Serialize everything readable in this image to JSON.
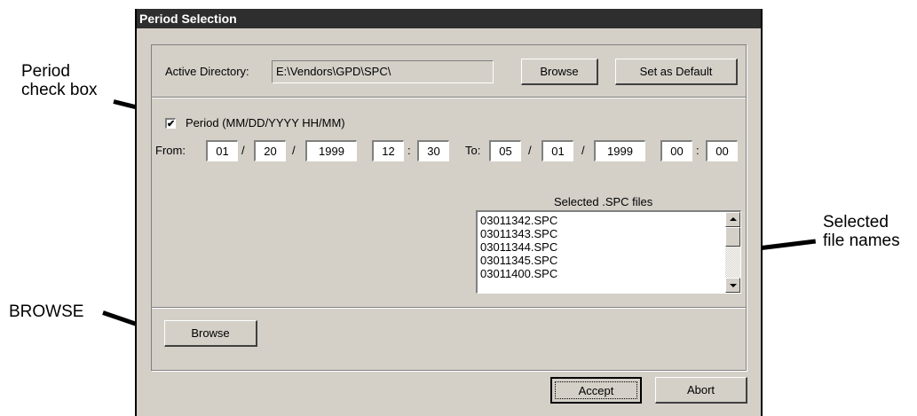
{
  "callouts": {
    "period_check_box": "Period\ncheck box",
    "browse": "BROWSE",
    "selected_file_names": "Selected\nfile names"
  },
  "dialog": {
    "title": "Period Selection",
    "active_directory_label": "Active Directory:",
    "active_directory_value": "E:\\Vendors\\GPD\\SPC\\",
    "browse_top_label": "Browse",
    "set_default_label": "Set as Default",
    "period_checked": true,
    "period_checkmark": "✔",
    "period_label": "Period (MM/DD/YYYY HH/MM)",
    "from_label": "From:",
    "to_label": "To:",
    "date_sep": "/",
    "time_sep": ":",
    "from": {
      "month": "01",
      "day": "20",
      "year": "1999",
      "hour": "12",
      "minute": "30"
    },
    "to": {
      "month": "05",
      "day": "01",
      "year": "1999",
      "hour": "00",
      "minute": "00"
    },
    "selected_files_label": "Selected .SPC files",
    "files": [
      "03011342.SPC",
      "03011343.SPC",
      "03011344.SPC",
      "03011345.SPC",
      "03011400.SPC"
    ],
    "browse_bottom_label": "Browse",
    "accept_label": "Accept",
    "abort_label": "Abort"
  },
  "colors": {
    "title_bar": "#2e2e2e",
    "dialog_face": "#d4d0c8"
  }
}
